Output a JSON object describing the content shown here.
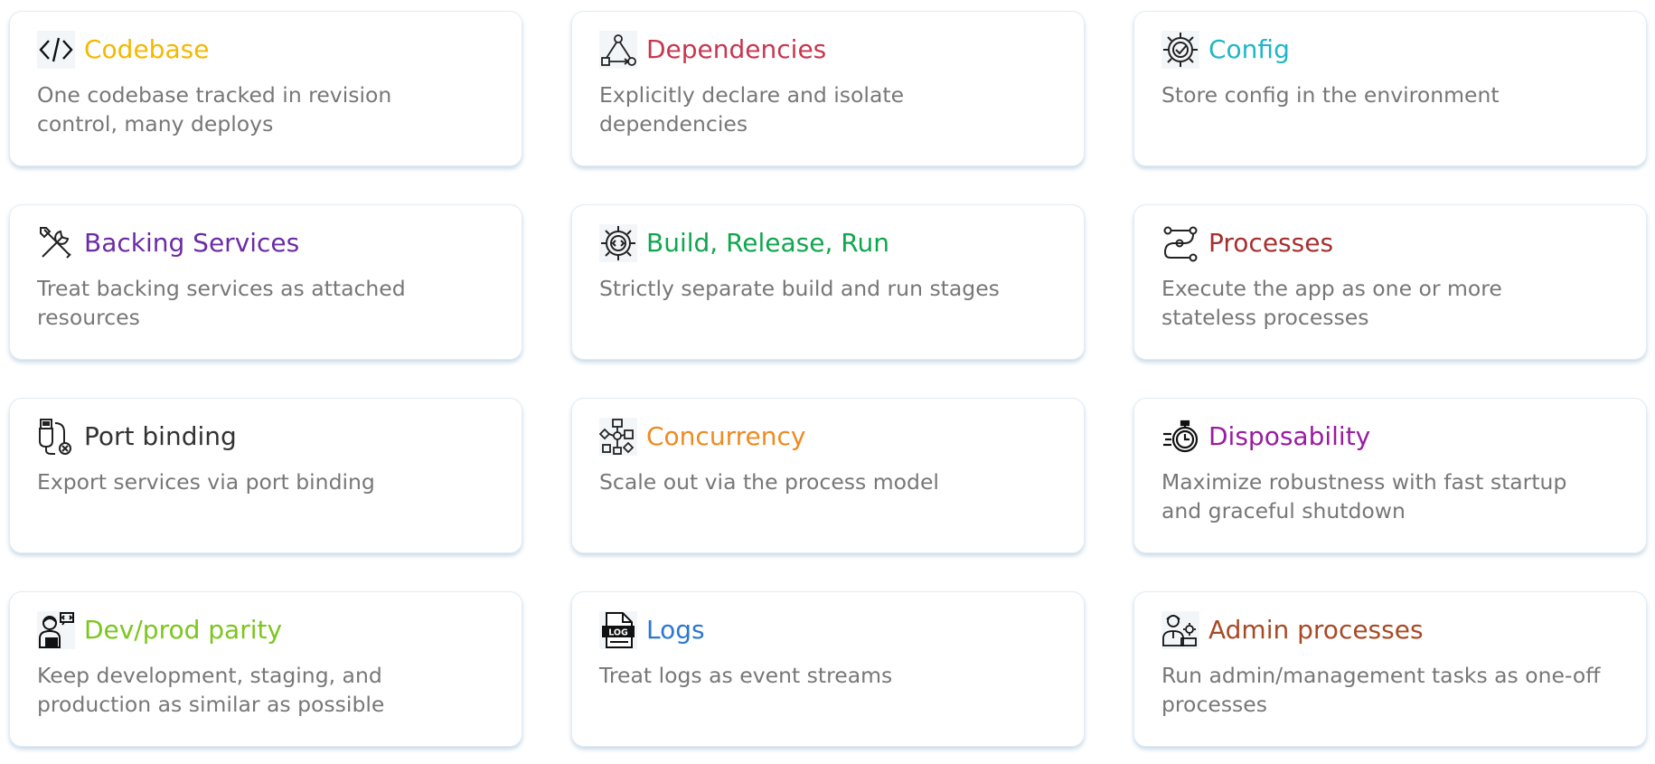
{
  "cards": [
    {
      "title": "Codebase",
      "description": "One codebase tracked in revision control, many deploys",
      "color": "#f5b800",
      "icon": "code-icon"
    },
    {
      "title": "Dependencies",
      "description": "Explicitly declare and isolate dependencies",
      "color": "#c8374f",
      "icon": "dependency-graph-icon"
    },
    {
      "title": "Config",
      "description": "Store config in the environment",
      "color": "#1fb6c9",
      "icon": "gear-check-icon"
    },
    {
      "title": "Backing Services",
      "description": "Treat backing services as attached resources",
      "color": "#6a2ca6",
      "icon": "tools-icon"
    },
    {
      "title": "Build, Release, Run",
      "description": "Strictly separate build and run stages",
      "color": "#10a650",
      "icon": "gear-code-icon"
    },
    {
      "title": "Processes",
      "description": "Execute the app as one or more stateless processes",
      "color": "#a5302f",
      "icon": "process-flow-icon"
    },
    {
      "title": "Port binding",
      "description": "Export services via port binding",
      "color": "#333333",
      "icon": "plug-icon"
    },
    {
      "title": "Concurrency",
      "description": "Scale out via the process model",
      "color": "#f08a1e",
      "icon": "concurrency-icon"
    },
    {
      "title": "Disposability",
      "description": "Maximize robustness with fast startup and graceful shutdown",
      "color": "#9a1ca0",
      "icon": "stopwatch-icon"
    },
    {
      "title": "Dev/prod parity",
      "description": "Keep development, staging, and production as similar as possible",
      "color": "#7cc61c",
      "icon": "developer-icon"
    },
    {
      "title": "Logs",
      "description": "Treat logs as event streams",
      "color": "#2c78d0",
      "icon": "log-file-icon"
    },
    {
      "title": "Admin processes",
      "description": "Run admin/management tasks as one-off processes",
      "color": "#a84a26",
      "icon": "admin-icon"
    }
  ]
}
